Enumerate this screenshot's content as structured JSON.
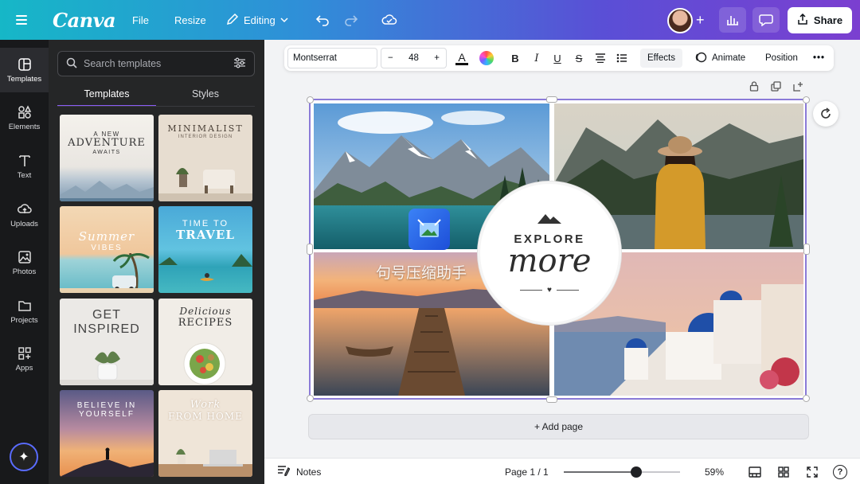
{
  "topbar": {
    "logo": "Canva",
    "file": "File",
    "resize": "Resize",
    "editing": "Editing",
    "share": "Share"
  },
  "rail": [
    {
      "label": "Templates",
      "icon": "templates-icon"
    },
    {
      "label": "Elements",
      "icon": "elements-icon"
    },
    {
      "label": "Text",
      "icon": "text-icon"
    },
    {
      "label": "Uploads",
      "icon": "uploads-icon"
    },
    {
      "label": "Photos",
      "icon": "photos-icon"
    },
    {
      "label": "Projects",
      "icon": "projects-icon"
    },
    {
      "label": "Apps",
      "icon": "apps-icon"
    }
  ],
  "panel": {
    "search_placeholder": "Search templates",
    "tabs": [
      "Templates",
      "Styles"
    ],
    "thumbs": [
      {
        "lines": [
          "A NEW",
          "ADVENTURE",
          "AWAITS"
        ]
      },
      {
        "lines": [
          "MINIMALIST",
          "INTERIOR DESIGN"
        ]
      },
      {
        "lines": [
          "Summer",
          "VIBES"
        ]
      },
      {
        "lines": [
          "TIME TO",
          "TRAVEL"
        ]
      },
      {
        "lines": [
          "GET",
          "INSPIRED"
        ]
      },
      {
        "lines": [
          "Delicious",
          "RECIPES"
        ]
      },
      {
        "lines": [
          "BELIEVE IN",
          "YOURSELF"
        ]
      },
      {
        "lines": [
          "Work",
          "FROM HOME"
        ]
      }
    ]
  },
  "toolbar": {
    "font": "Montserrat",
    "size": "48",
    "effects": "Effects",
    "animate": "Animate",
    "position": "Position"
  },
  "design": {
    "explore": "EXPLORE",
    "more": "more",
    "watermark": "句号压缩助手"
  },
  "add_page": "+ Add page",
  "bottombar": {
    "notes": "Notes",
    "page": "Page 1 / 1",
    "zoom": "59%",
    "zoom_level": 0.62
  },
  "colors": {
    "accent": "#8b5cf6",
    "rail_bg": "#18191b",
    "panel_bg": "#252627"
  }
}
